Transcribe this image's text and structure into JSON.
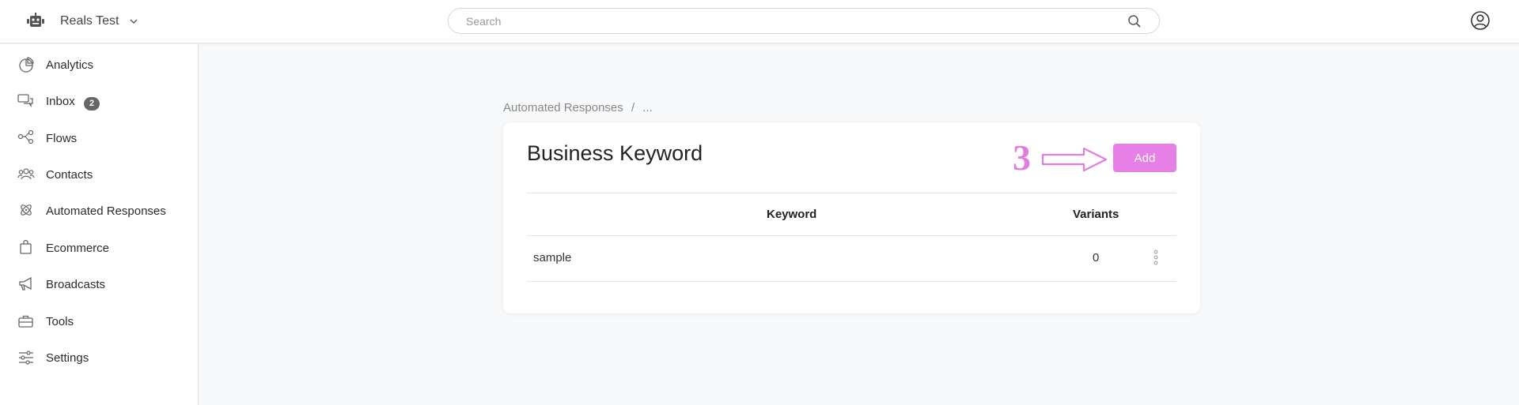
{
  "header": {
    "workspace_name": "Reals Test",
    "search_placeholder": "Search",
    "search_value": ""
  },
  "sidebar": {
    "items": [
      {
        "label": "Analytics",
        "icon": "pie-chart-icon"
      },
      {
        "label": "Inbox",
        "icon": "chat-bubbles-icon",
        "badge": "2"
      },
      {
        "label": "Flows",
        "icon": "flow-nodes-icon"
      },
      {
        "label": "Contacts",
        "icon": "people-icon"
      },
      {
        "label": "Automated Responses",
        "icon": "atom-icon"
      },
      {
        "label": "Ecommerce",
        "icon": "shopping-bag-icon"
      },
      {
        "label": "Broadcasts",
        "icon": "megaphone-icon"
      },
      {
        "label": "Tools",
        "icon": "toolbox-icon"
      },
      {
        "label": "Settings",
        "icon": "sliders-icon"
      }
    ]
  },
  "breadcrumb": {
    "parent": "Automated Responses",
    "separator": "/",
    "current": "..."
  },
  "card": {
    "title": "Business Keyword",
    "annotation_number": "3",
    "add_label": "Add",
    "columns": {
      "keyword": "Keyword",
      "variants": "Variants"
    },
    "rows": [
      {
        "keyword": "sample",
        "variants": "0"
      }
    ]
  },
  "colors": {
    "accent": "#e67fe6",
    "annotation": "#e07ee0",
    "badge": "#666666"
  }
}
